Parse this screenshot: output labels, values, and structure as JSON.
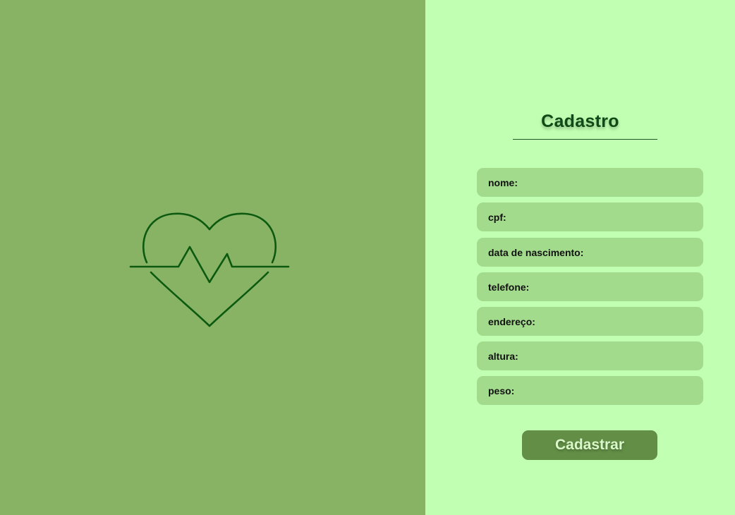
{
  "colors": {
    "left_panel": "#89b364",
    "right_panel": "#c1ffb2",
    "field_bg": "#a3db8c",
    "button_bg": "#628e46",
    "icon_stroke": "#0b5a10",
    "title_text": "#0f4a17"
  },
  "logo": {
    "icon": "heartbeat-icon"
  },
  "form": {
    "title": "Cadastro",
    "fields": [
      {
        "label": "nome:"
      },
      {
        "label": "cpf:"
      },
      {
        "label": "data de nascimento:"
      },
      {
        "label": "telefone:"
      },
      {
        "label": "endereço:"
      },
      {
        "label": "altura:"
      },
      {
        "label": "peso:"
      }
    ],
    "submit_label": "Cadastrar"
  }
}
